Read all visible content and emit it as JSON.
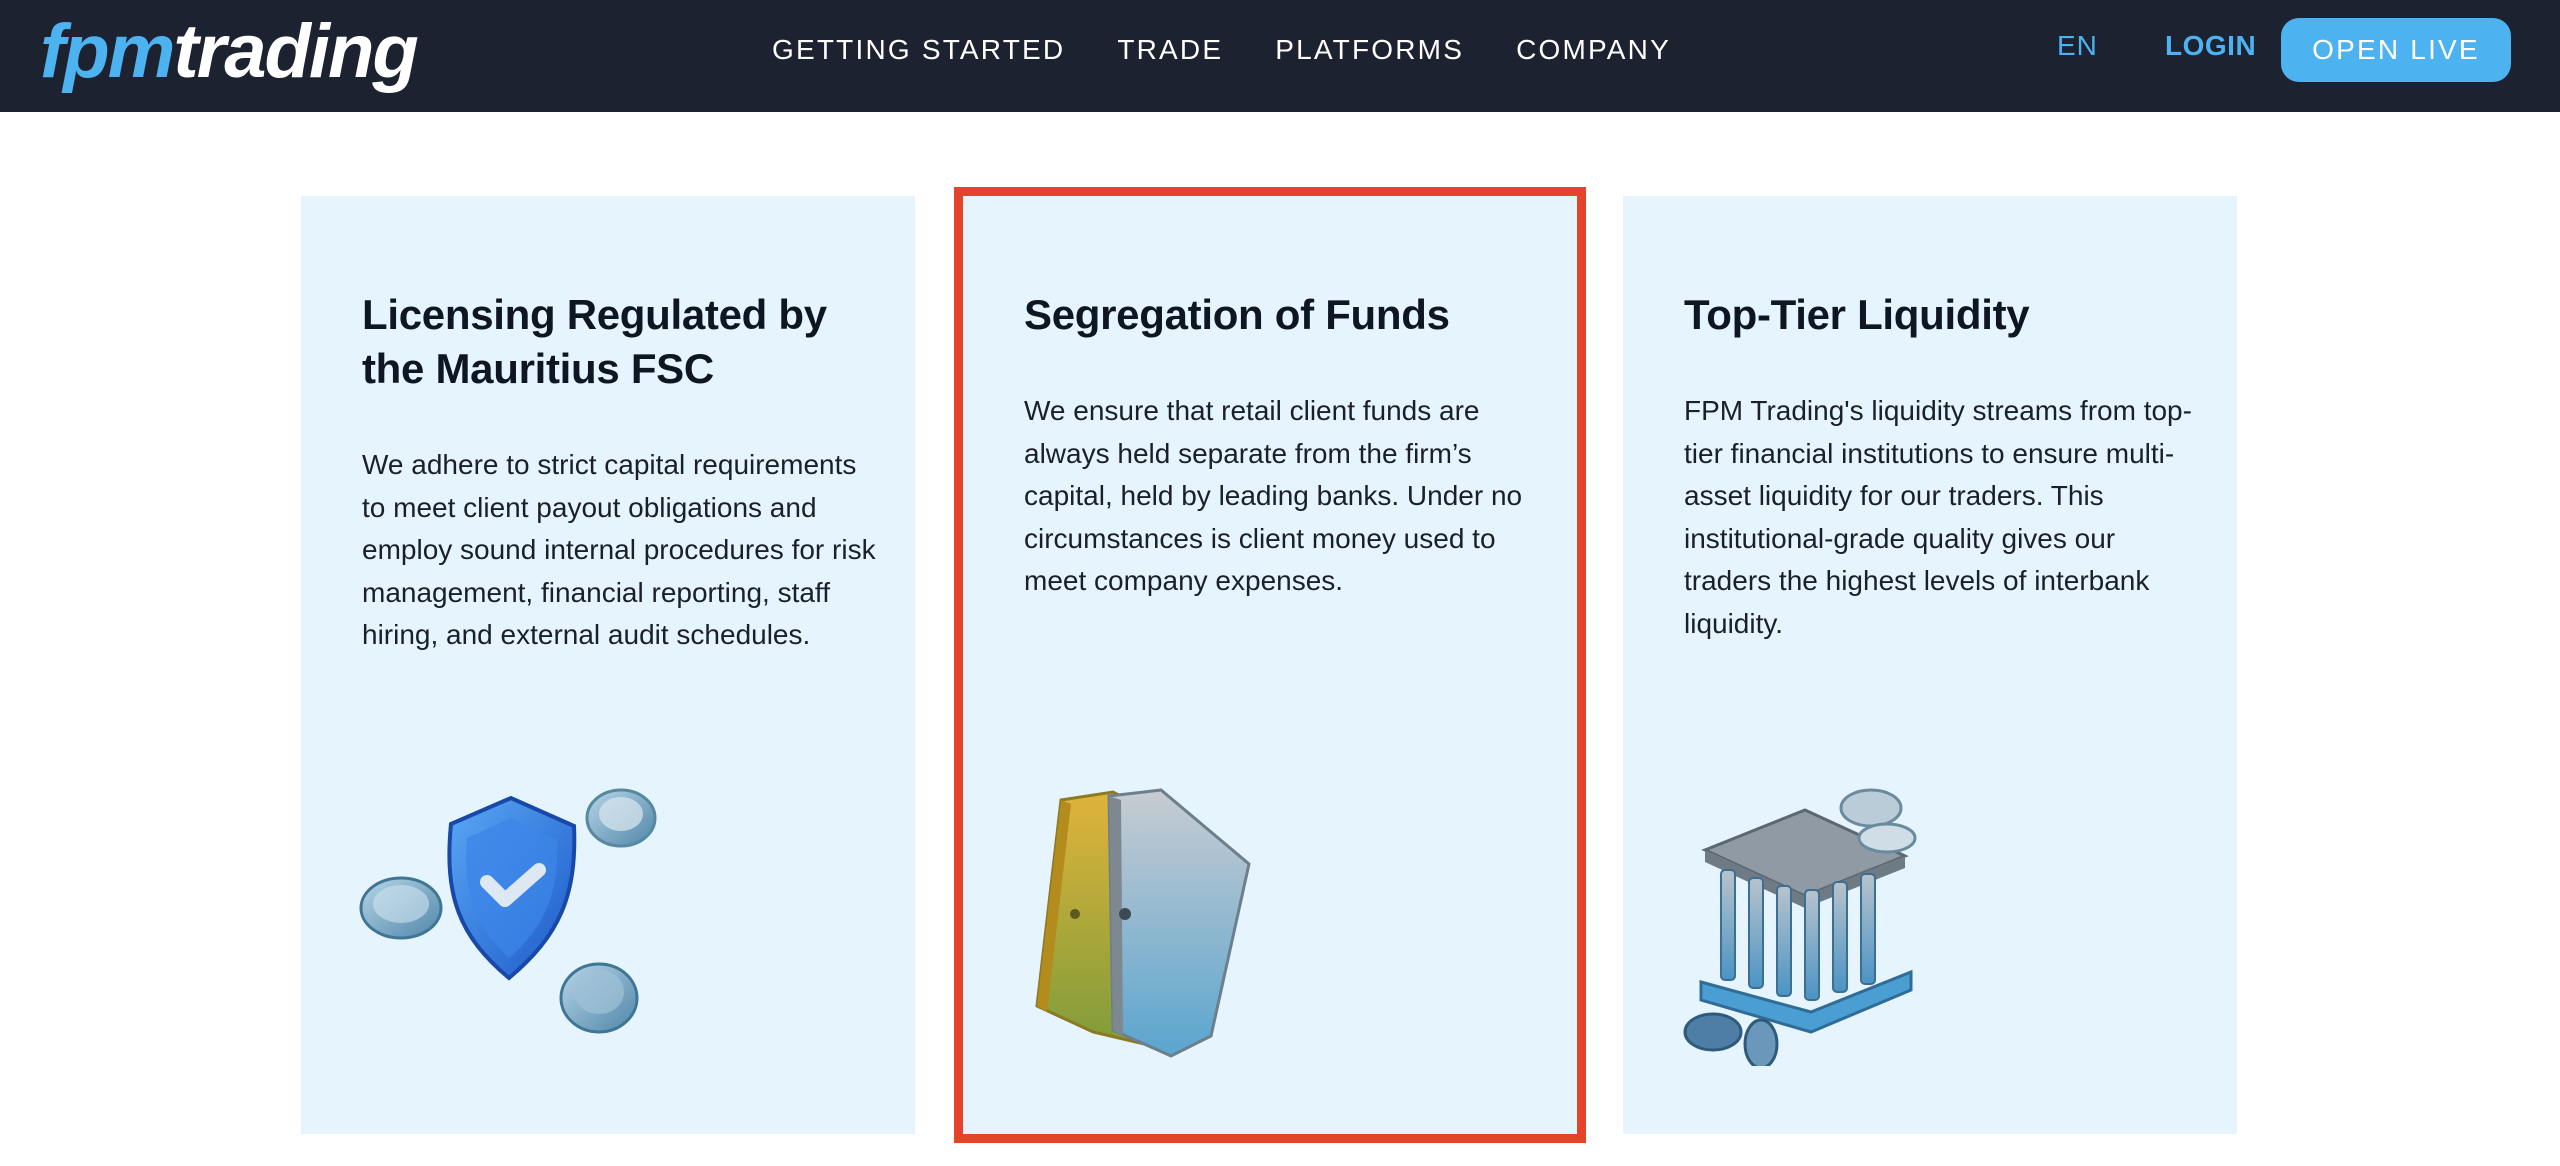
{
  "header": {
    "logo_part1": "fpm",
    "logo_part2": "trading",
    "nav": [
      "GETTING STARTED",
      "TRADE",
      "PLATFORMS",
      "COMPANY"
    ],
    "language": "EN",
    "login_label": "LOGIN",
    "cta_label": "OPEN LIVE"
  },
  "cards": [
    {
      "title": "Licensing Regulated by the Mauritius FSC",
      "body": "We adhere to strict capital requirements to meet client payout obligations and employ sound internal procedures for risk management, financial reporting, staff hiring, and external audit schedules.",
      "icon": "shield-coins-icon"
    },
    {
      "title": "Segregation of Funds",
      "body": "We ensure that retail client funds are always held separate from the firm’s capital, held by leading banks. Under no circumstances is client money used to meet company expenses.",
      "icon": "binders-icon",
      "highlighted": true
    },
    {
      "title": "Top-Tier Liquidity",
      "body": "FPM Trading's liquidity streams from top-tier financial institutions to ensure multi-asset liquidity for our traders. This institutional-grade quality gives our traders the highest levels of interbank liquidity.",
      "icon": "bank-coins-icon"
    }
  ],
  "colors": {
    "header_bg": "#1d2231",
    "accent": "#4cb2f0",
    "card_bg": "#e6f5fd",
    "highlight_border": "#e5442b"
  }
}
